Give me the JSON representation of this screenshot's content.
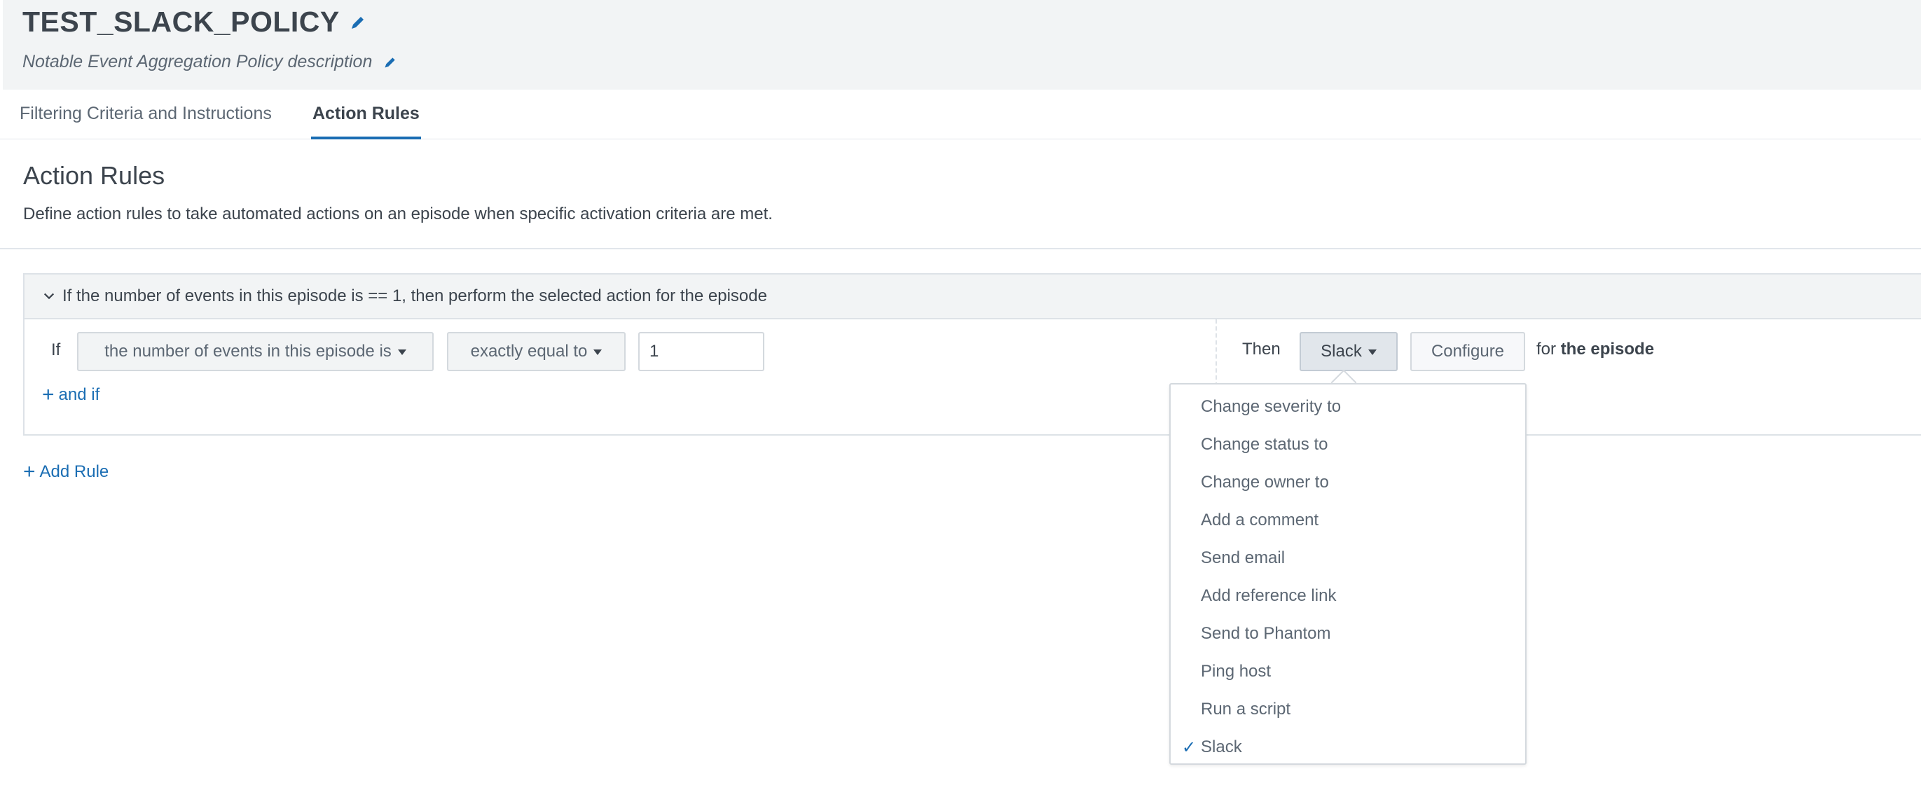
{
  "header": {
    "title": "TEST_SLACK_POLICY",
    "description": "Notable Event Aggregation Policy description"
  },
  "tabs": [
    {
      "label": "Filtering Criteria and Instructions",
      "active": false
    },
    {
      "label": "Action Rules",
      "active": true
    }
  ],
  "section": {
    "title": "Action Rules",
    "description": "Define action rules to take automated actions on an episode when specific activation criteria are met."
  },
  "rule": {
    "summary": "If the number of events in this episode is == 1, then perform the selected action for the episode",
    "if_label": "If",
    "field_value": "the number of events in this episode is",
    "operator_value": "exactly equal to",
    "input_value": "1",
    "and_if_label": "and if",
    "then_label": "Then",
    "action_value": "Slack",
    "configure_label": "Configure",
    "for_prefix": "for",
    "for_target": "the episode"
  },
  "add_rule_label": "Add Rule",
  "action_menu": {
    "items": [
      {
        "label": "Change severity to",
        "selected": false
      },
      {
        "label": "Change status to",
        "selected": false
      },
      {
        "label": "Change owner to",
        "selected": false
      },
      {
        "label": "Add a comment",
        "selected": false
      },
      {
        "label": "Send email",
        "selected": false
      },
      {
        "label": "Add reference link",
        "selected": false
      },
      {
        "label": "Send to Phantom",
        "selected": false
      },
      {
        "label": "Ping host",
        "selected": false
      },
      {
        "label": "Run a script",
        "selected": false
      },
      {
        "label": "Slack",
        "selected": true
      }
    ],
    "check_glyph": "✓"
  },
  "colors": {
    "accent": "#1a6db3",
    "text": "#3c444d",
    "muted": "#5c6773",
    "header_bg": "#f2f4f5"
  }
}
